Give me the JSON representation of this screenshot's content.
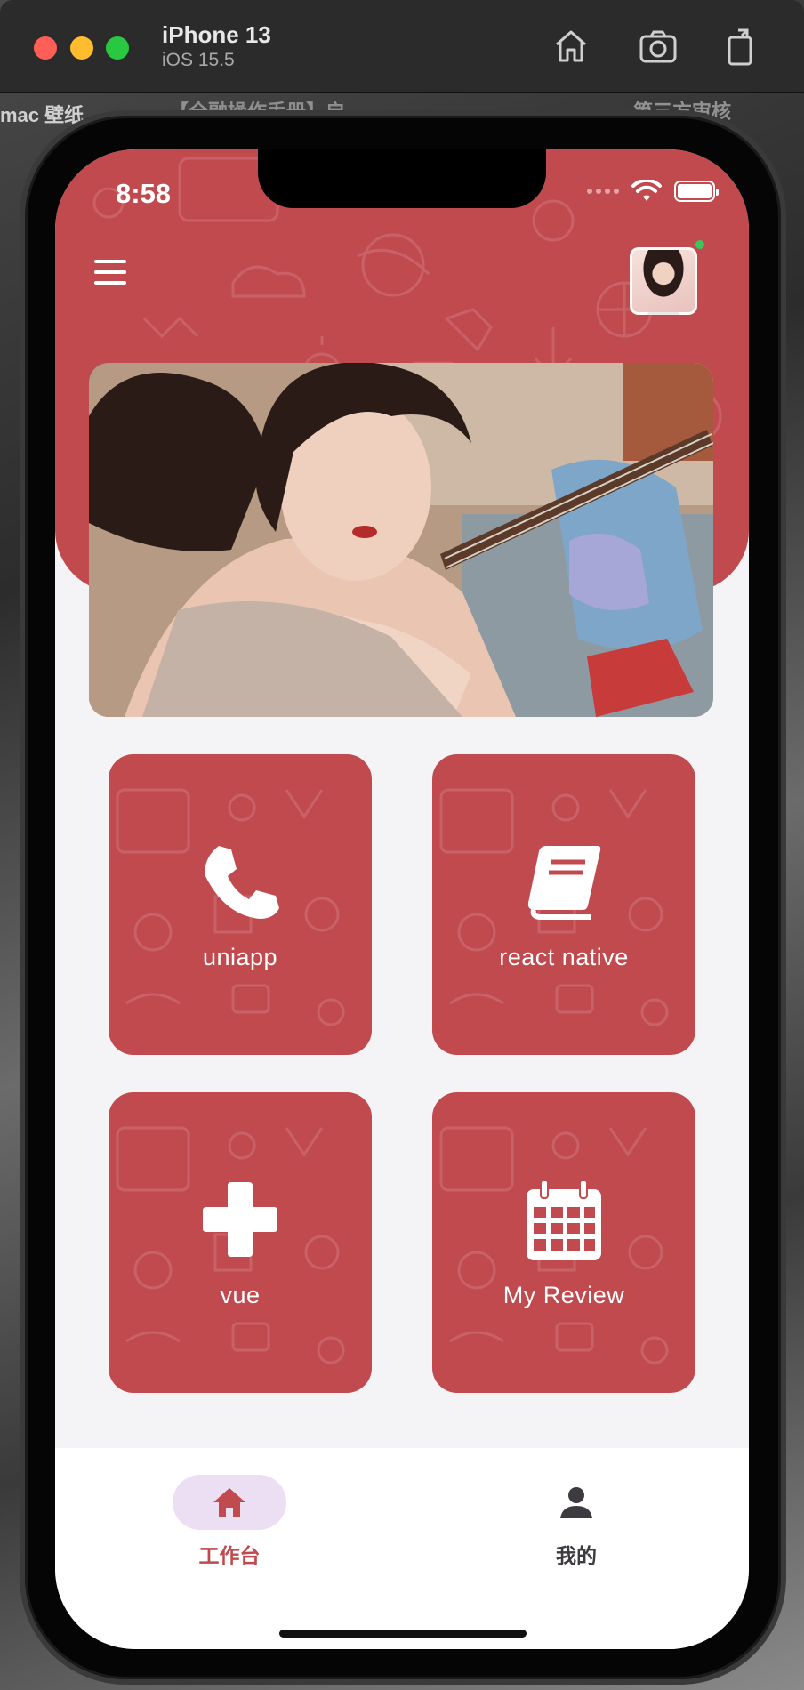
{
  "simulator": {
    "device": "iPhone 13",
    "os": "iOS 15.5",
    "toolbar_icons": [
      "home-icon",
      "screenshot-icon",
      "rotate-icon"
    ]
  },
  "desktop_fragments": {
    "left_text": "mac 壁纸",
    "mid_text": "【全融操作手册】启",
    "right_text": "第三方审核"
  },
  "status_bar": {
    "time": "8:58"
  },
  "header": {
    "menu_icon": "hamburger-menu-icon",
    "accent_color": "#c14a4f"
  },
  "grid": {
    "tiles": [
      {
        "label": "uniapp",
        "icon": "phone-icon"
      },
      {
        "label": "react native",
        "icon": "book-icon"
      },
      {
        "label": "vue",
        "icon": "plus-icon"
      },
      {
        "label": "My Review",
        "icon": "calendar-icon"
      }
    ]
  },
  "tabbar": {
    "tabs": [
      {
        "label": "工作台",
        "icon": "home-icon",
        "active": true
      },
      {
        "label": "我的",
        "icon": "person-icon",
        "active": false
      }
    ]
  }
}
